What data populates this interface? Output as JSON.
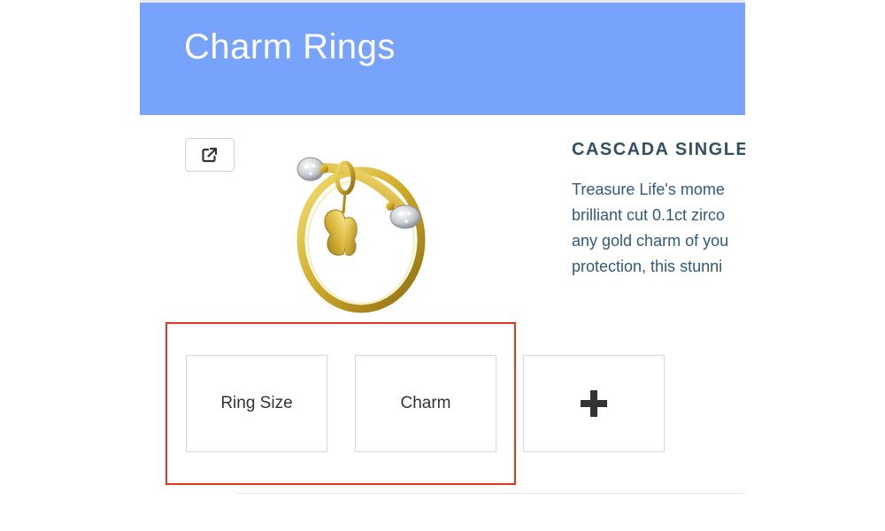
{
  "header": {
    "title": "Charm Rings",
    "background_color": "#77a3fc"
  },
  "product": {
    "share_button_icon": "external-link-icon",
    "image_alt": "gold ring with butterfly charm",
    "title": "CASCADA SINGLE",
    "description_lines": [
      "Treasure Life's mome",
      "brilliant cut 0.1ct zirco",
      "any gold charm of you",
      "protection, this stunni"
    ]
  },
  "options": {
    "ring_size_label": "Ring Size",
    "charm_label": "Charm",
    "add_icon": "plus-icon"
  },
  "highlight": {
    "color": "#e8331e",
    "target": "Ring Size and Charm options"
  }
}
